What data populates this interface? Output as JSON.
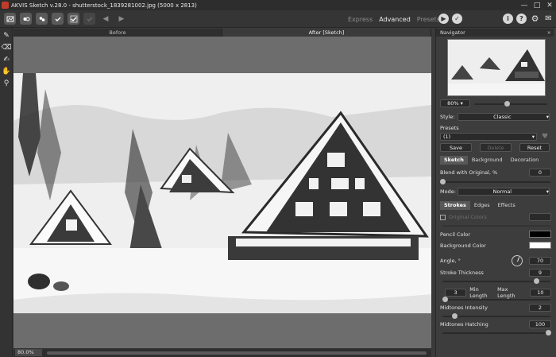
{
  "window": {
    "title": "AKVIS Sketch v.28.0 - shutterstock_1839281002.jpg (5000 x 2813)",
    "minimize_glyph": "—",
    "maximize_glyph": "□",
    "close_glyph": "✕"
  },
  "toolbar": {
    "modes": {
      "express": "Express",
      "advanced": "Advanced",
      "presets": "Presets"
    },
    "icons": [
      "open-image-icon",
      "save-image-icon",
      "print-icon",
      "batch-icon",
      "share-icon",
      "preferences-icon",
      "undo-icon",
      "redo-icon",
      "run-icon",
      "apply-icon",
      "info-icon",
      "help-icon",
      "settings-icon",
      "feed-icon"
    ]
  },
  "view_tabs": {
    "before": "Before",
    "after": "After [Sketch]"
  },
  "status": {
    "zoom": "80.0%"
  },
  "navigator": {
    "title": "Navigator",
    "zoom": "80%"
  },
  "settings": {
    "style_label": "Style:",
    "style_value": "Classic",
    "presets_label": "Presets",
    "preset_value": "(1)",
    "save": "Save",
    "delete": "Delete",
    "reset": "Reset",
    "tabs": [
      "Sketch",
      "Background",
      "Decoration"
    ],
    "blend_label": "Blend with Original, %",
    "blend_value": "0",
    "mode_label": "Mode:",
    "mode_value": "Normal",
    "subtabs": [
      "Strokes",
      "Edges",
      "Effects"
    ],
    "original_colors_label": "Original Colors",
    "pencil_color_label": "Pencil Color",
    "pencil_color": "#000000",
    "background_color_label": "Background Color",
    "background_color": "#ffffff",
    "angle_label": "Angle, °",
    "angle_value": "70",
    "stroke_thickness_label": "Stroke Thickness",
    "stroke_thickness_value": "9",
    "min_length_value": "3",
    "min_length_label": "Min Length",
    "max_length_label": "Max Length",
    "max_length_value": "10",
    "midtones_intensity_label": "Midtones Intensity",
    "midtones_intensity_value": "2",
    "midtones_hatching_label": "Midtones Hatching",
    "midtones_hatching_value": "100"
  }
}
